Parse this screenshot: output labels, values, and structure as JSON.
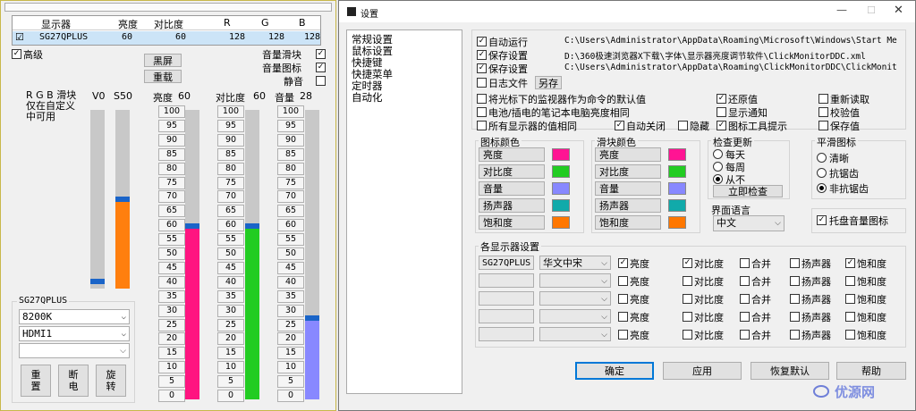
{
  "left": {
    "table_headers": [
      "显示器",
      "亮度",
      "对比度",
      "R",
      "G",
      "B"
    ],
    "row": {
      "check": "☑",
      "name": "SG27QPLUS",
      "brightness": "60",
      "contrast": "60",
      "r": "128",
      "g": "128",
      "b": "128"
    },
    "advanced": "高级",
    "black_screen": "黑屏",
    "reload": "重载",
    "vol_slider": "音量滑块",
    "vol_icon": "音量图标",
    "mute": "静音",
    "rgb_note": "R G B 滑块\n仅在自定义\n中可用",
    "v0": "V0",
    "s50": "S50",
    "brightness_label": "亮度",
    "brightness_val": "60",
    "contrast_label": "对比度",
    "contrast_val": "60",
    "volume_label": "音量",
    "volume_val": "28",
    "ticks": [
      "100",
      "95",
      "90",
      "85",
      "80",
      "75",
      "70",
      "65",
      "60",
      "55",
      "50",
      "45",
      "40",
      "35",
      "30",
      "25",
      "20",
      "15",
      "10",
      "5",
      "0"
    ],
    "monitor_group": "SG27QPLUS",
    "color_temp": "8200K",
    "input": "HDMI1",
    "btn_reset": "重\n置",
    "btn_off": "断\n电",
    "btn_rotate": "旋\n转",
    "levels": {
      "v0": 0.04,
      "s50": 0.5,
      "brightness": 0.6,
      "contrast": 0.6,
      "volume": 0.28
    }
  },
  "settings": {
    "title": "设置",
    "nav": [
      "常规设置",
      "鼠标设置",
      "快捷键",
      "快捷菜单",
      "定时器",
      "自动化"
    ],
    "autorun": "自动运行",
    "autorun_path": "C:\\Users\\Administrator\\AppData\\Roaming\\Microsoft\\Windows\\Start Me",
    "save1": "保存设置",
    "save1_path": "D:\\360极速浏览器X下载\\字体\\显示器亮度调节软件\\ClickMonitorDDC.xml",
    "save2": "保存设置",
    "save2_path": "C:\\Users\\Administrator\\AppData\\Roaming\\ClickMonitorDDC\\ClickMonit",
    "log": "日志文件",
    "save_as": "另存",
    "opt_default": "将光标下的监视器作为命令的默认值",
    "opt_laptop": "电池/插电的笔记本电脑亮度相同",
    "opt_same": "所有显示器的值相同",
    "auto_close": "自动关闭",
    "hide": "隐藏",
    "restore": "还原值",
    "show_notify": "显示通知",
    "tray_tooltip": "图标工具提示",
    "reread": "重新读取",
    "verify": "校验值",
    "keep": "保存值",
    "icon_color": "图标颜色",
    "slider_color": "滑块颜色",
    "color_rows": [
      "亮度",
      "对比度",
      "音量",
      "扬声器",
      "饱和度"
    ],
    "icon_swatches": [
      "#ff1493",
      "#22cc22",
      "#8888ff",
      "#11aaaa",
      "#ff7700"
    ],
    "slider_swatches": [
      "#ff1493",
      "#22cc22",
      "#8888ff",
      "#11aaaa",
      "#ff7700"
    ],
    "update_check": "检查更新",
    "update_opts": [
      "每天",
      "每周",
      "从不"
    ],
    "check_now": "立即检查",
    "ui_lang": "界面语言",
    "lang": "中文",
    "smooth_icon": "平滑图标",
    "smooth_opts": [
      "清晰",
      "抗锯齿",
      "非抗锯齿"
    ],
    "tray_volume": "托盘音量图标",
    "per_monitor": "各显示器设置",
    "monitor_name": "SG27QPLUS",
    "font": "华文中宋",
    "col_labels": [
      "亮度",
      "对比度",
      "合并",
      "扬声器",
      "饱和度"
    ],
    "btn_ok": "确定",
    "btn_apply": "应用",
    "btn_restore": "恢复默认",
    "btn_help": "帮助",
    "watermark": "优源网"
  }
}
